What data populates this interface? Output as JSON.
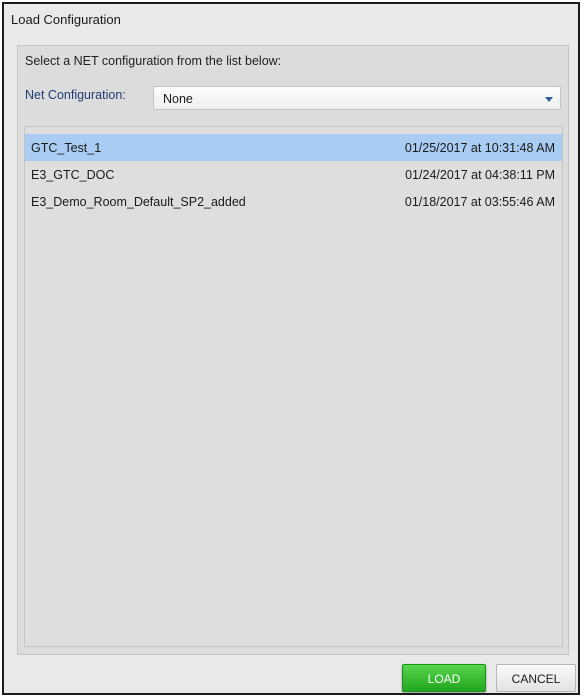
{
  "dialog": {
    "title": "Load Configuration",
    "prompt": "Select a NET configuration from the list below:"
  },
  "net_config": {
    "label": "Net Configuration:",
    "selected": "None",
    "arrow_icon": "chevron-down-icon"
  },
  "list": {
    "items": [
      {
        "name": "GTC_Test_1",
        "date": "01/25/2017 at 10:31:48 AM",
        "selected": true
      },
      {
        "name": "E3_GTC_DOC",
        "date": "01/24/2017 at 04:38:11 PM",
        "selected": false
      },
      {
        "name": "E3_Demo_Room_Default_SP2_added",
        "date": "01/18/2017 at 03:55:46 AM",
        "selected": false
      }
    ]
  },
  "buttons": {
    "load": "LOAD",
    "cancel": "CANCEL"
  },
  "colors": {
    "selected_row": "#a9cdf2",
    "load_button": "#2dbb28",
    "label_blue": "#1e3d73"
  }
}
